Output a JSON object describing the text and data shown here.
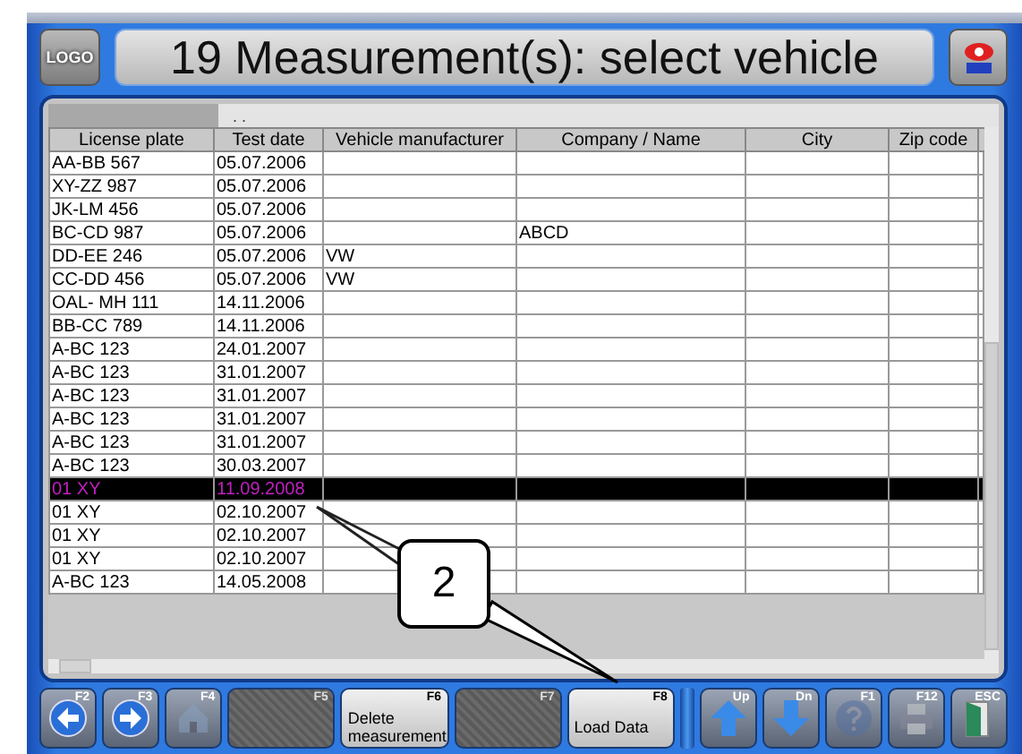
{
  "header": {
    "logo": "LOGO",
    "title": "19 Measurement(s): select vehicle"
  },
  "table": {
    "path": ". .",
    "columns": [
      "License plate",
      "Test date",
      "Vehicle manufacturer",
      "Company / Name",
      "City",
      "Zip code"
    ],
    "rows": [
      {
        "cells": [
          "AA-BB 567",
          "05.07.2006",
          "",
          "",
          "",
          ""
        ],
        "selected": false
      },
      {
        "cells": [
          "XY-ZZ 987",
          "05.07.2006",
          "",
          "",
          "",
          ""
        ],
        "selected": false
      },
      {
        "cells": [
          "JK-LM 456",
          "05.07.2006",
          "",
          "",
          "",
          ""
        ],
        "selected": false
      },
      {
        "cells": [
          "BC-CD 987",
          "05.07.2006",
          "",
          "ABCD",
          "",
          ""
        ],
        "selected": false
      },
      {
        "cells": [
          "DD-EE 246",
          "05.07.2006",
          "VW",
          "",
          "",
          ""
        ],
        "selected": false
      },
      {
        "cells": [
          "CC-DD 456",
          "05.07.2006",
          "VW",
          "",
          "",
          ""
        ],
        "selected": false
      },
      {
        "cells": [
          "OAL- MH 111",
          "14.11.2006",
          "",
          "",
          "",
          ""
        ],
        "selected": false
      },
      {
        "cells": [
          "BB-CC 789",
          "14.11.2006",
          "",
          "",
          "",
          ""
        ],
        "selected": false
      },
      {
        "cells": [
          "A-BC 123",
          "24.01.2007",
          "",
          "",
          "",
          ""
        ],
        "selected": false
      },
      {
        "cells": [
          "A-BC 123",
          "31.01.2007",
          "",
          "",
          "",
          ""
        ],
        "selected": false
      },
      {
        "cells": [
          "A-BC 123",
          "31.01.2007",
          "",
          "",
          "",
          ""
        ],
        "selected": false
      },
      {
        "cells": [
          "A-BC 123",
          "31.01.2007",
          "",
          "",
          "",
          ""
        ],
        "selected": false
      },
      {
        "cells": [
          "A-BC 123",
          "31.01.2007",
          "",
          "",
          "",
          ""
        ],
        "selected": false
      },
      {
        "cells": [
          "A-BC 123",
          "30.03.2007",
          "",
          "",
          "",
          ""
        ],
        "selected": false
      },
      {
        "cells": [
          "01 XY",
          "11.09.2008",
          "",
          "",
          "",
          ""
        ],
        "selected": true
      },
      {
        "cells": [
          "01 XY",
          "02.10.2007",
          "",
          "",
          "",
          ""
        ],
        "selected": false
      },
      {
        "cells": [
          "01 XY",
          "02.10.2007",
          "",
          "",
          "",
          ""
        ],
        "selected": false
      },
      {
        "cells": [
          "01 XY",
          "02.10.2007",
          "",
          "",
          "",
          ""
        ],
        "selected": false
      },
      {
        "cells": [
          "A-BC 123",
          "14.05.2008",
          "",
          "",
          "",
          ""
        ],
        "selected": false
      }
    ]
  },
  "callout": {
    "label": "2"
  },
  "toolbar": [
    {
      "key": "F2",
      "kind": "back",
      "disabled": false
    },
    {
      "key": "F3",
      "kind": "forward",
      "disabled": false
    },
    {
      "key": "F4",
      "kind": "home",
      "disabled": true
    },
    {
      "key": "F5",
      "kind": "blank",
      "disabled": true
    },
    {
      "key": "F6",
      "kind": "text",
      "label": "Delete measurement",
      "disabled": false
    },
    {
      "key": "F7",
      "kind": "blank",
      "disabled": true
    },
    {
      "key": "F8",
      "kind": "text",
      "label": "Load Data",
      "disabled": false
    },
    {
      "key": "Up",
      "kind": "up",
      "disabled": false
    },
    {
      "key": "Dn",
      "kind": "down",
      "disabled": false
    },
    {
      "key": "F1",
      "kind": "help",
      "disabled": true
    },
    {
      "key": "F12",
      "kind": "print",
      "disabled": true
    },
    {
      "key": "ESC",
      "kind": "exit",
      "disabled": false
    }
  ]
}
